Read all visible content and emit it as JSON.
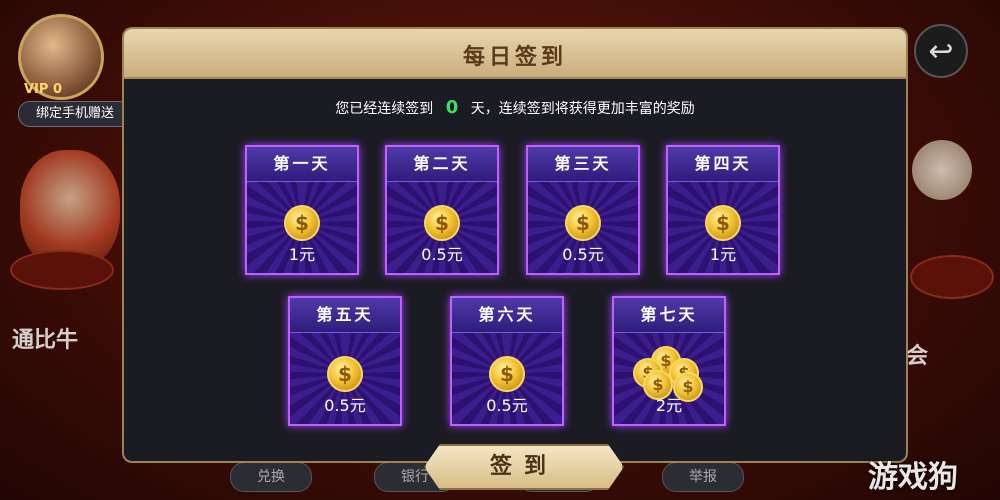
{
  "background": {
    "vip": "VIP 0",
    "bind_phone": "绑定手机赠送",
    "promo_left": "通比牛",
    "promo_right": "会",
    "bottom_buttons": [
      "兑换",
      "银行",
      "",
      "举报"
    ]
  },
  "dialog": {
    "title": "每日签到",
    "info_prefix": "您已经连续签到",
    "streak_days": "0",
    "info_suffix": "天，连续签到将获得更加丰富的奖励",
    "days": [
      {
        "label": "第一天",
        "reward": "1元",
        "icon": "coin-icon"
      },
      {
        "label": "第二天",
        "reward": "0.5元",
        "icon": "coin-icon"
      },
      {
        "label": "第三天",
        "reward": "0.5元",
        "icon": "coin-icon"
      },
      {
        "label": "第四天",
        "reward": "1元",
        "icon": "coin-icon"
      },
      {
        "label": "第五天",
        "reward": "0.5元",
        "icon": "coin-icon"
      },
      {
        "label": "第六天",
        "reward": "0.5元",
        "icon": "coin-icon"
      },
      {
        "label": "第七天",
        "reward": "2元",
        "icon": "coin-pile-icon"
      }
    ],
    "signin_button": "签到"
  },
  "back_icon": "back-arrow-icon",
  "watermark": "游戏狗",
  "colors": {
    "streak": "#3fe060",
    "card_border": "#c060ff",
    "header_gold": "#d7bd86"
  }
}
